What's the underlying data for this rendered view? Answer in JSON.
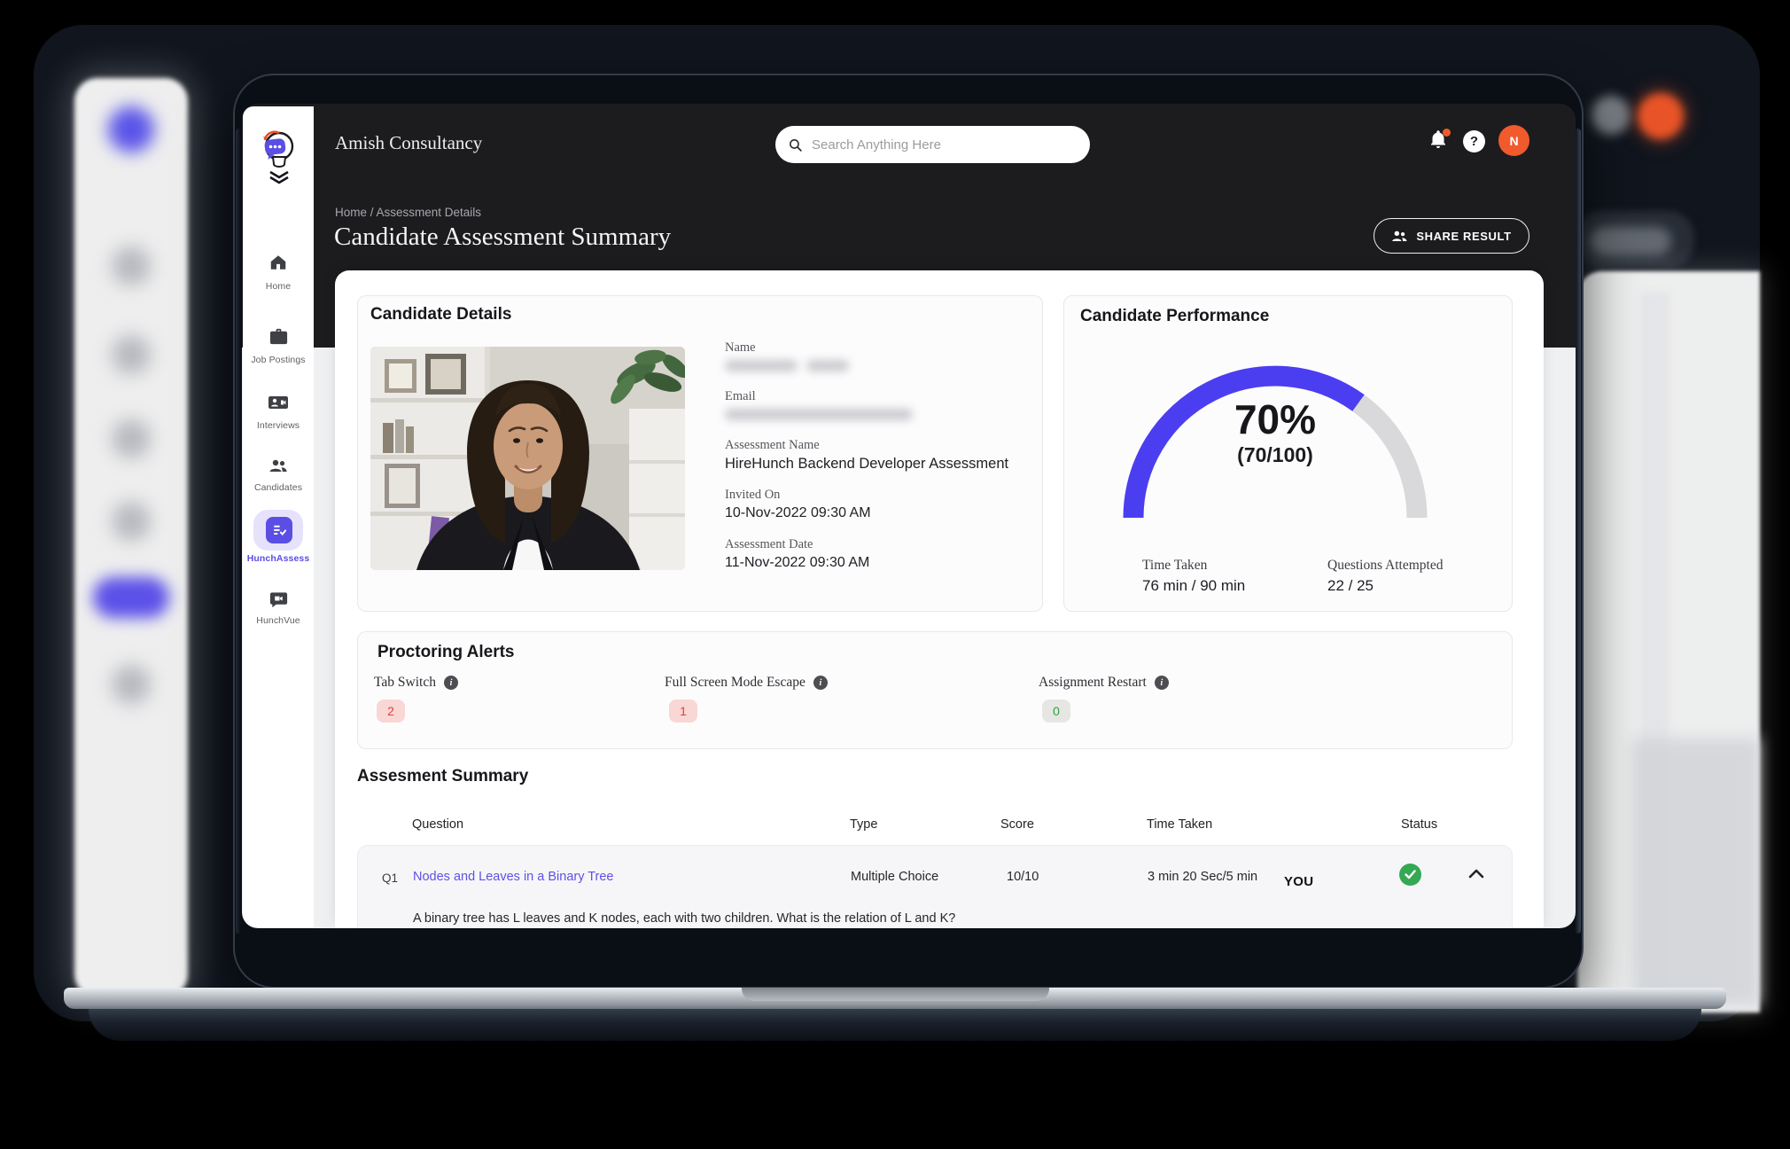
{
  "header": {
    "company": "Amish Consultancy",
    "search_placeholder": "Search Anything Here",
    "avatar_initial": "N"
  },
  "sidebar": {
    "items": [
      {
        "label": "Home",
        "icon": "home-icon",
        "active": false
      },
      {
        "label": "Job Postings",
        "icon": "briefcase-icon",
        "active": false
      },
      {
        "label": "Interviews",
        "icon": "interview-card-icon",
        "active": false
      },
      {
        "label": "Candidates",
        "icon": "people-icon",
        "active": false
      },
      {
        "label": "HunchAssess",
        "icon": "assessment-checklist-icon",
        "active": true
      },
      {
        "label": "HunchVue",
        "icon": "video-chat-icon",
        "active": false
      }
    ]
  },
  "page": {
    "breadcrumb": "Home / Assessment Details",
    "title": "Candidate Assessment Summary",
    "share_button": "SHARE RESULT"
  },
  "candidate_details": {
    "heading": "Candidate Details",
    "fields": [
      {
        "label": "Name",
        "redacted": true
      },
      {
        "label": "Email",
        "redacted": true
      },
      {
        "label": "Assessment Name",
        "value": "HireHunch Backend Developer Assessment"
      },
      {
        "label": "Invited On",
        "value": "10-Nov-2022 09:30 AM"
      },
      {
        "label": "Assessment Date",
        "value": "11-Nov-2022 09:30 AM"
      }
    ]
  },
  "performance": {
    "heading": "Candidate Performance",
    "score_percent": "70%",
    "score_fraction": "(70/100)",
    "gauge": {
      "type": "gauge",
      "percent": 70,
      "max": 100,
      "filled_color": "#4b3ef0",
      "track_color": "#d9d9db"
    },
    "stats": [
      {
        "label": "Time Taken",
        "value": "76 min / 90 min"
      },
      {
        "label": "Questions Attempted",
        "value": "22 / 25"
      }
    ]
  },
  "proctoring": {
    "heading": "Proctoring Alerts",
    "alerts": [
      {
        "label": "Tab Switch",
        "count": "2",
        "level": "alert"
      },
      {
        "label": "Full Screen Mode Escape",
        "count": "1",
        "level": "alert"
      },
      {
        "label": "Assignment Restart",
        "count": "0",
        "level": "ok"
      }
    ]
  },
  "summary": {
    "heading": "Assesment Summary",
    "columns": [
      "Question",
      "Type",
      "Score",
      "Time Taken",
      "Status"
    ],
    "rows": [
      {
        "id": "Q1",
        "question": "Nodes and Leaves in a Binary Tree",
        "type": "Multiple Choice",
        "score": "10/10",
        "time": "3 min 20 Sec/5 min",
        "cursor_label": "YOU",
        "status": "correct",
        "detail": "A binary tree has L leaves and K nodes, each with two children.  What is the relation of L and K?"
      }
    ]
  },
  "colors": {
    "accent_purple": "#5b4ee4",
    "gauge_blue": "#4b3ef0",
    "avatar_orange": "#f05a2c",
    "success_green": "#34a853",
    "alert_red": "#e0403f"
  }
}
